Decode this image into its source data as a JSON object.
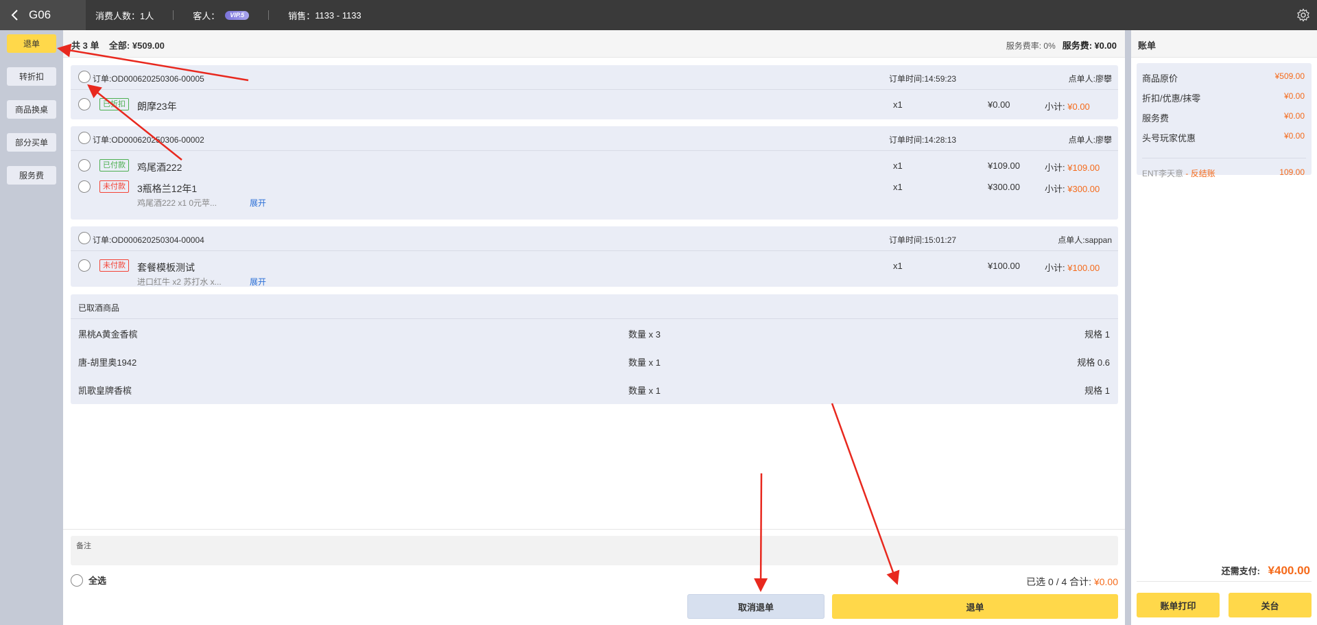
{
  "header": {
    "room": "G06",
    "consumers_label": "消费人数",
    "consumers_value": "1人",
    "guest_label": "客人",
    "vip_badge": "VIP.5",
    "sales_label": "销售",
    "sales_value": "1133 - 1133"
  },
  "sidebar": {
    "items": [
      {
        "label": "退单",
        "active": true
      },
      {
        "label": "转折扣",
        "active": false
      },
      {
        "label": "商品换桌",
        "active": false
      },
      {
        "label": "部分买单",
        "active": false
      },
      {
        "label": "服务费",
        "active": false
      }
    ]
  },
  "summary": {
    "count_text": "共 3 单",
    "total_label": "全部:",
    "total_value": "¥509.00",
    "service_rate_label": "服务费率:",
    "service_rate_value": "0%",
    "service_fee_label": "服务费:",
    "service_fee_value": "¥0.00"
  },
  "orders": [
    {
      "order_label": "订单:",
      "order_no": "OD000620250306-00005",
      "time_label": "订单时间:",
      "time": "14:59:23",
      "by_label": "点单人:",
      "by": "廖攀",
      "items": [
        {
          "tag": "已折扣",
          "tag_color": "green",
          "name": "朗摩23年",
          "qty": "x1",
          "price": "¥0.00",
          "subtotal_label": "小计:",
          "subtotal": "¥0.00"
        }
      ]
    },
    {
      "order_label": "订单:",
      "order_no": "OD000620250306-00002",
      "time_label": "订单时间:",
      "time": "14:28:13",
      "by_label": "点单人:",
      "by": "廖攀",
      "items": [
        {
          "tag": "已付款",
          "tag_color": "green",
          "name": "鸡尾酒222",
          "qty": "x1",
          "price": "¥109.00",
          "subtotal_label": "小计:",
          "subtotal": "¥109.00"
        },
        {
          "tag": "未付款",
          "tag_color": "red",
          "name": "3瓶格兰12年1",
          "qty": "x1",
          "price": "¥300.00",
          "subtotal_label": "小计:",
          "subtotal": "¥300.00",
          "detail": "鸡尾酒222 x1   0元苹...",
          "expand": "展开"
        }
      ]
    },
    {
      "order_label": "订单:",
      "order_no": "OD000620250304-00004",
      "time_label": "订单时间:",
      "time": "15:01:27",
      "by_label": "点单人:",
      "by": "sappan",
      "items": [
        {
          "tag": "未付款",
          "tag_color": "red",
          "name": "套餐模板测试",
          "qty": "x1",
          "price": "¥100.00",
          "subtotal_label": "小计:",
          "subtotal": "¥100.00",
          "detail": "进口红牛 x2   苏打水 x...",
          "expand": "展开"
        }
      ]
    }
  ],
  "taken": {
    "title": "已取酒商品",
    "rows": [
      {
        "name": "黑桃A黄金香槟",
        "qty": "数量 x 3",
        "spec": "规格 1"
      },
      {
        "name": "唐-胡里奥1942",
        "qty": "数量 x 1",
        "spec": "规格 0.6"
      },
      {
        "name": "凯歌皇牌香槟",
        "qty": "数量 x 1",
        "spec": "规格 1"
      }
    ]
  },
  "footer": {
    "remark_label": "备注",
    "select_all": "全选",
    "selected_text": "已选 0 / 4 合计:",
    "selected_amount": "¥0.00",
    "cancel_button": "取消退单",
    "refund_button": "退单"
  },
  "bill": {
    "title": "账单",
    "rows": [
      {
        "label": "商品原价",
        "value": "¥509.00"
      },
      {
        "label": "折扣/优惠/抹零",
        "value": "¥0.00"
      },
      {
        "label": "服务费",
        "value": "¥0.00"
      },
      {
        "label": "头号玩家优惠",
        "value": "¥0.00"
      }
    ],
    "ent_name": "ENT李天意",
    "ent_sep": " - ",
    "ent_status": "反结账",
    "ent_value": "109.00",
    "due_label": "还需支付:",
    "due_value": "¥400.00",
    "print_button": "账单打印",
    "close_button": "关台"
  },
  "colors": {
    "accent_yellow": "#ffd84a",
    "orange": "#f56a1a",
    "topbar": "#3a3a3a",
    "card_bg": "#eaedf6",
    "annotation_arrow": "#e8281e"
  }
}
